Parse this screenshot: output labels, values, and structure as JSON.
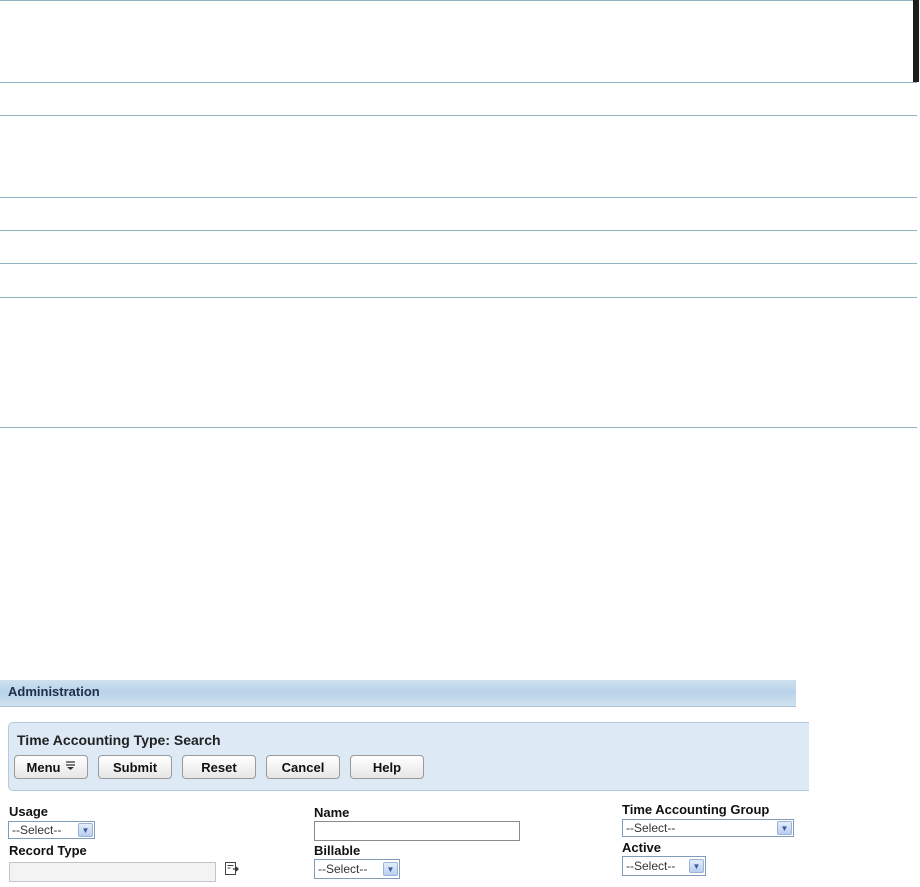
{
  "window": {
    "section_title": "Administration",
    "page_title": "Time Accounting Type: Search"
  },
  "toolbar": {
    "menu_label": "Menu",
    "submit_label": "Submit",
    "reset_label": "Reset",
    "cancel_label": "Cancel",
    "help_label": "Help"
  },
  "form": {
    "usage": {
      "label": "Usage",
      "selected": "--Select--"
    },
    "record_type": {
      "label": "Record Type",
      "value": ""
    },
    "name": {
      "label": "Name",
      "value": ""
    },
    "billable": {
      "label": "Billable",
      "selected": "--Select--"
    },
    "time_accounting_group": {
      "label": "Time Accounting Group",
      "selected": "--Select--"
    },
    "active": {
      "label": "Active",
      "selected": "--Select--"
    }
  },
  "icons": {
    "menu": "menu-dropdown-icon",
    "dropdown": "chevron-down-icon",
    "lookup": "lookup-icon"
  },
  "colors": {
    "header_bar": "#b9d3ea",
    "panel": "#dde9f4",
    "rule_lines": "#8fb3c3"
  }
}
